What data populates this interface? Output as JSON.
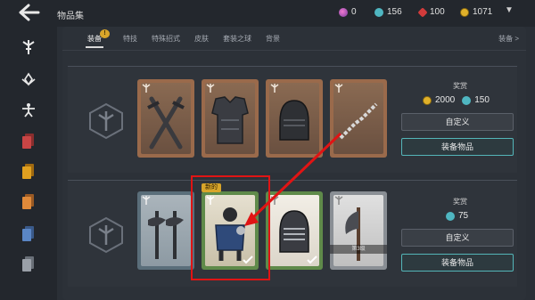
{
  "header": {
    "title": "物品集",
    "currencies": [
      {
        "name": "orb",
        "value": "0",
        "color": "#c94a9e"
      },
      {
        "name": "gem-teal",
        "value": "156",
        "color": "#4fb6c1"
      },
      {
        "name": "ruby",
        "value": "100",
        "color": "#d23b3b"
      },
      {
        "name": "coin",
        "value": "1071",
        "color": "#e0b12a"
      }
    ]
  },
  "tabs": [
    {
      "label": "装备",
      "active": true
    },
    {
      "label": "特技"
    },
    {
      "label": "特殊招式"
    },
    {
      "label": "皮肤"
    },
    {
      "label": "套装之球"
    },
    {
      "label": "背景"
    }
  ],
  "tab_badge": "!",
  "tabs_more": "装备 >",
  "sidebar": {
    "items": [
      {
        "icon": "sword-emblem-icon",
        "color": "#e8e8e8"
      },
      {
        "icon": "lotus-icon",
        "color": "#e8e8e8"
      },
      {
        "icon": "figure-icon",
        "color": "#e8e8e8"
      },
      {
        "icon": "cards-red-icon",
        "color": "#c94545"
      },
      {
        "icon": "cards-gold-icon",
        "color": "#e0a020"
      },
      {
        "icon": "cards-orange-icon",
        "color": "#e08a3a"
      },
      {
        "icon": "cards-blue-icon",
        "color": "#5a86c5"
      },
      {
        "icon": "cards-gray-icon",
        "color": "#9aa0a8"
      }
    ]
  },
  "sets": [
    {
      "reward_title": "奖赏",
      "reward_coin": "2000",
      "reward_gem": "150",
      "custom_label": "自定义",
      "equip_label": "装备物品",
      "cards": [
        {
          "item": "swords",
          "frame": "#9a6a4b",
          "art": "#7a5f4a"
        },
        {
          "item": "armor",
          "frame": "#9a6a4b",
          "art": "#7a5f4a"
        },
        {
          "item": "helmet",
          "frame": "#9a6a4b",
          "art": "#7a5f4a"
        },
        {
          "item": "chain",
          "frame": "#9a6a4b",
          "art": "#7a5f4a"
        }
      ]
    },
    {
      "reward_title": "奖赏",
      "reward_gem": "75",
      "custom_label": "自定义",
      "equip_label": "装备物品",
      "cards": [
        {
          "item": "axes",
          "frame": "#5a6e7a",
          "art": "#8d9aa3"
        },
        {
          "item": "knight",
          "frame": "#5f8a4a",
          "art": "#d8d2c0",
          "new": "新的",
          "owned": true
        },
        {
          "item": "great-helm",
          "frame": "#5f8a4a",
          "art": "#eae6dc",
          "owned": true
        },
        {
          "item": "battle-axe",
          "frame": "#8a8f95",
          "art": "#cfcfcf",
          "locked": "第3级"
        }
      ]
    }
  ]
}
